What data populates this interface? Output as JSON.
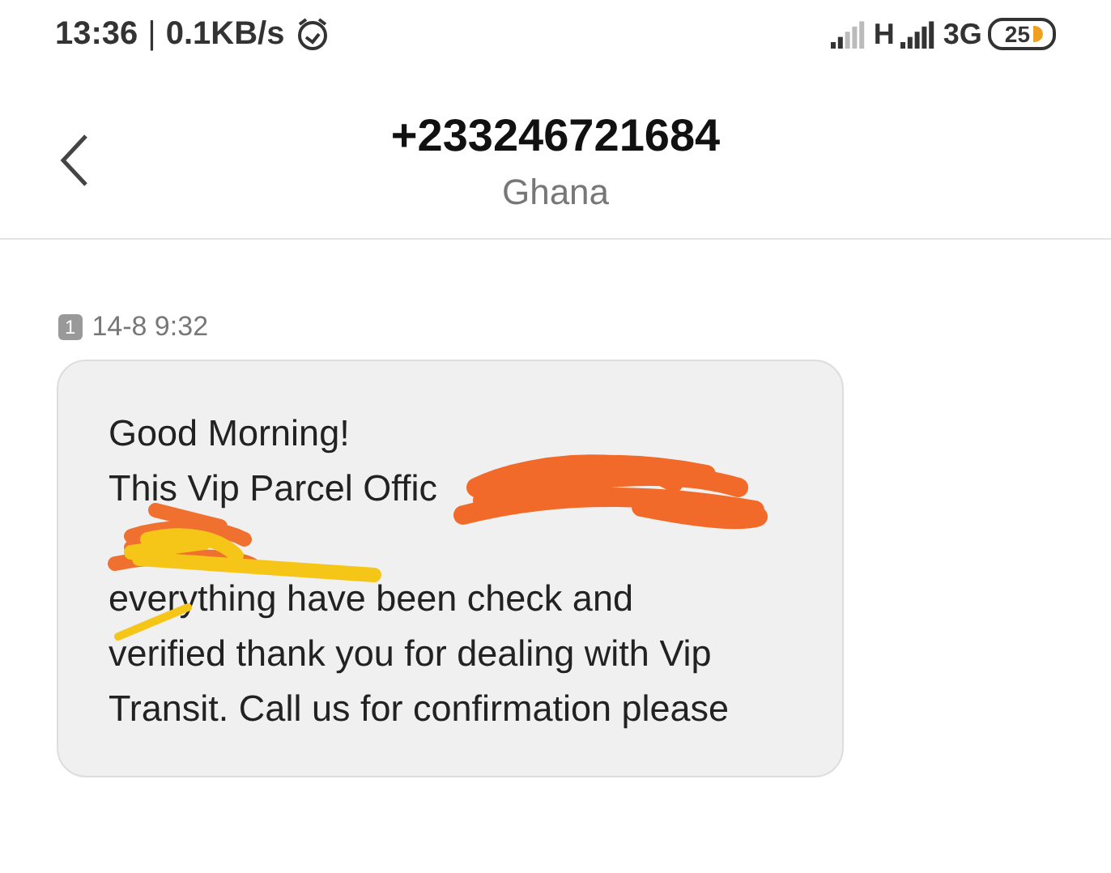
{
  "status_bar": {
    "time": "13:36",
    "separator": "|",
    "speed": "0.1KB/s",
    "network_1": "H",
    "network_2": "3G",
    "battery": "25"
  },
  "header": {
    "title": "+233246721684",
    "subtitle": "Ghana"
  },
  "message": {
    "sim": "1",
    "timestamp": "14-8 9:32",
    "lines": [
      {
        "kind": "text",
        "text": "Good Morning!"
      },
      {
        "kind": "text",
        "text": "This Vip Parcel Offic"
      },
      {
        "kind": "redacted"
      },
      {
        "kind": "text",
        "text": "everything have been check and"
      },
      {
        "kind": "text",
        "text": "verified thank you for dealing with Vip"
      },
      {
        "kind": "text",
        "text": "Transit. Call us for confirmation please"
      }
    ]
  }
}
